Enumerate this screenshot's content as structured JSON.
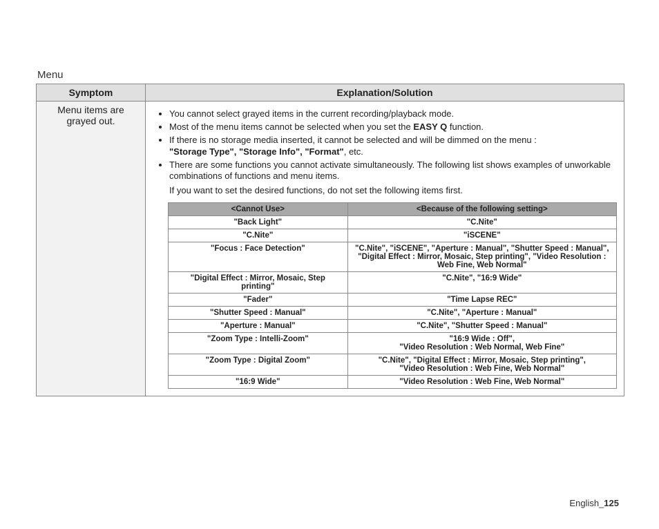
{
  "section_title": "Menu",
  "headers": {
    "symptom": "Symptom",
    "explanation": "Explanation/Solution"
  },
  "symptom_text": "Menu items are grayed out.",
  "bullets": {
    "b1": "You cannot select grayed items in the current recording/playback mode.",
    "b2_a": "Most of the menu items cannot be selected when you set the ",
    "b2_bold": "EASY Q",
    "b2_b": " function.",
    "b3_a": "If there is no storage media inserted, it cannot be selected and will be dimmed on the menu :",
    "b3_bold": "\"Storage Type\", \"Storage Info\", \"Format\"",
    "b3_b": ", etc.",
    "b4": "There are some functions you cannot activate simultaneously. The following list shows examples of unworkable combinations of functions and menu items."
  },
  "plain_line": "If you want to set the desired functions, do not set the following items first.",
  "inner_headers": {
    "left": "<Cannot Use>",
    "right": "<Because of the following setting>"
  },
  "rows": [
    {
      "l": "\"Back Light\"",
      "r": "\"C.Nite\""
    },
    {
      "l": "\"C.Nite\"",
      "r": "\"iSCENE\""
    },
    {
      "l": "\"Focus : Face Detection\"",
      "r": "\"C.Nite\", \"iSCENE\", \"Aperture : Manual\", \"Shutter Speed : Manual\", \"Digital Effect : Mirror, Mosaic, Step printing\", \"Video Resolution : Web Fine, Web Normal\""
    },
    {
      "l": "\"Digital Effect : Mirror, Mosaic, Step printing\"",
      "r": "\"C.Nite\", \"16:9 Wide\""
    },
    {
      "l": "\"Fader\"",
      "r": "\"Time Lapse REC\""
    },
    {
      "l": "\"Shutter Speed : Manual\"",
      "r": "\"C.Nite\", \"Aperture : Manual\""
    },
    {
      "l": "\"Aperture : Manual\"",
      "r": "\"C.Nite\", \"Shutter Speed : Manual\""
    },
    {
      "l": "\"Zoom Type : Intelli-Zoom\"",
      "r": "\"16:9 Wide : Off\",\n\"Video Resolution : Web Normal, Web Fine\""
    },
    {
      "l": "\"Zoom Type : Digital Zoom\"",
      "r": "\"C.Nite\", \"Digital Effect : Mirror, Mosaic, Step printing\",\n\"Video Resolution : Web Fine, Web Normal\""
    },
    {
      "l": "\"16:9 Wide\"",
      "r": "\"Video Resolution : Web Fine, Web Normal\""
    }
  ],
  "footer": {
    "lang": "English_",
    "page": "125"
  }
}
